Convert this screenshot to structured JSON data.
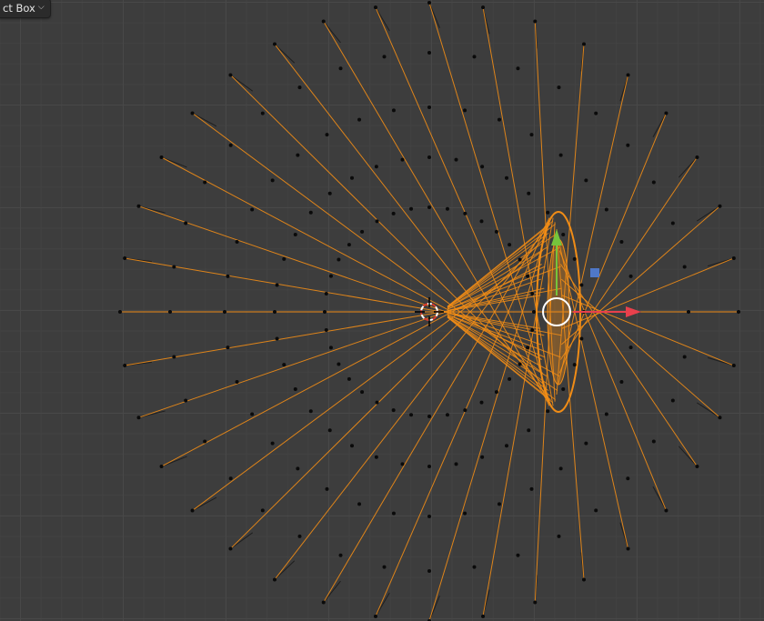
{
  "header": {
    "select_tool_label": "ct Box",
    "select_tool_icon": "chevron-down-icon"
  },
  "colors": {
    "background": "#3d3d3d",
    "grid_major": "#484848",
    "grid_minor": "#424242",
    "selected_edge": "#f08c16",
    "unselected_edge": "#1e1e1e",
    "vertex": "#0a0a0a",
    "gizmo_x_axis": "#e8404c",
    "gizmo_y_axis": "#76c43c",
    "gizmo_plane_handle": "#4f78c8",
    "gizmo_circle": "#ffffff",
    "cursor_ring_red": "#d83a2c",
    "cursor_ring_white": "#ffffff"
  },
  "scene": {
    "tool": "transform-gizmo",
    "icons": [
      "3d-cursor-icon",
      "move-gizmo-icon"
    ]
  }
}
